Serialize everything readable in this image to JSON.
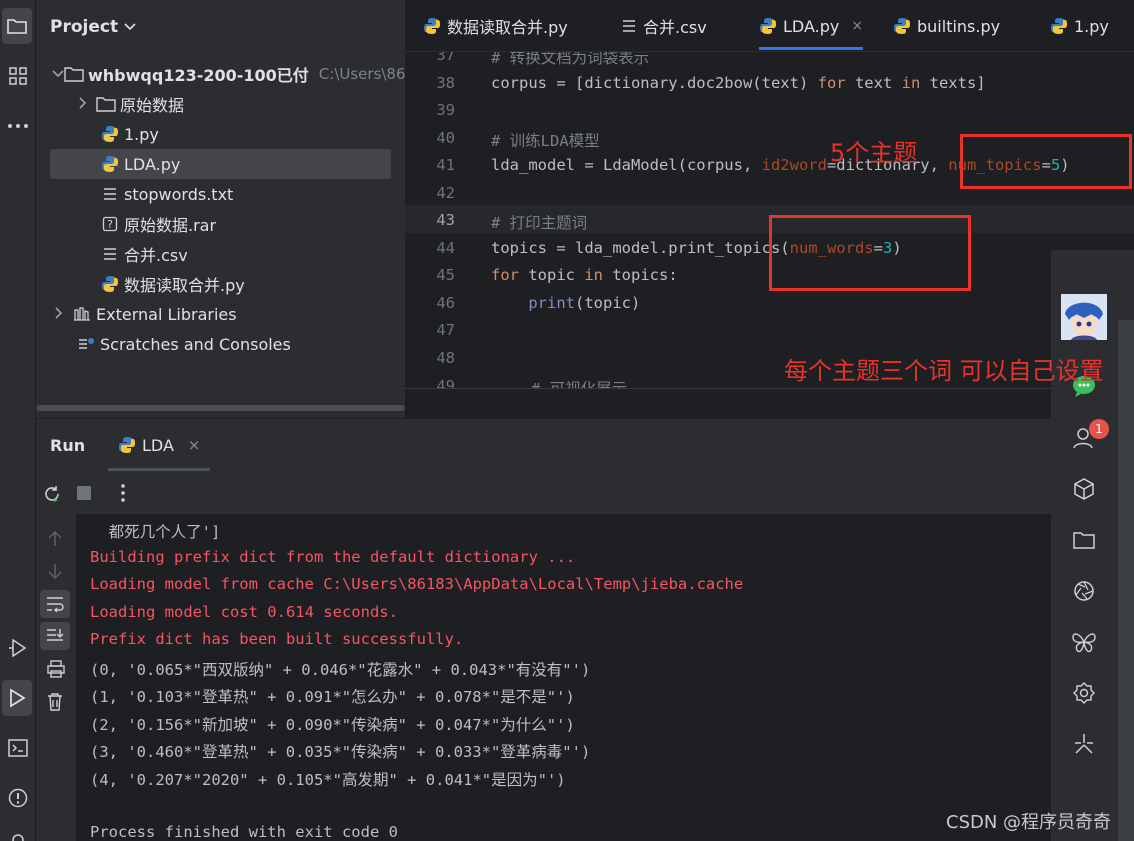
{
  "project": {
    "header": "Project",
    "tree": [
      {
        "label": "whbwqq123-200-100已付",
        "sub": "C:\\Users\\86",
        "type": "folder",
        "expanded": true
      },
      {
        "label": "原始数据",
        "type": "folder",
        "expanded": false
      },
      {
        "label": "1.py",
        "type": "python"
      },
      {
        "label": "LDA.py",
        "type": "python",
        "selected": true
      },
      {
        "label": "stopwords.txt",
        "type": "text"
      },
      {
        "label": "原始数据.rar",
        "type": "unknown"
      },
      {
        "label": "合并.csv",
        "type": "text"
      },
      {
        "label": "数据读取合并.py",
        "type": "python"
      },
      {
        "label": "External Libraries",
        "type": "library"
      },
      {
        "label": "Scratches and Consoles",
        "type": "scratch"
      }
    ]
  },
  "editor": {
    "tabs": [
      {
        "label": "数据读取合并.py",
        "type": "python"
      },
      {
        "label": "合并.csv",
        "type": "text"
      },
      {
        "label": "LDA.py",
        "type": "python",
        "active": true,
        "close": "×"
      },
      {
        "label": "builtins.py",
        "type": "python"
      },
      {
        "label": "1.py",
        "type": "python"
      }
    ],
    "line_numbers": [
      "37",
      "38",
      "39",
      "40",
      "41",
      "42",
      "43",
      "44",
      "45",
      "46",
      "47",
      "48",
      "49"
    ],
    "lines": {
      "l37": "# 转换文档为词袋表示",
      "l38_a": "corpus = [dictionary.doc2bow(text) ",
      "l38_for": "for",
      "l38_b": " text ",
      "l38_in": "in",
      "l38_c": " texts]",
      "l40": "# 训练LDA模型",
      "l41_a": "lda_model = LdaModel(corpus, ",
      "l41_p1": "id2word",
      "l41_b": "=dictionary, ",
      "l41_p2": "num_topics",
      "l41_eq": "=",
      "l41_n": "5",
      "l41_c": ")",
      "l43": "# 打印主题词",
      "l44_a": "topics = lda_model.print_topics(",
      "l44_p": "num_words",
      "l44_eq": "=",
      "l44_n": "3",
      "l44_c": ")",
      "l45_for": "for",
      "l45_a": " topic ",
      "l45_in": "in",
      "l45_b": " topics:",
      "l46_fn": "print",
      "l46_a": "(topic)",
      "l49": "# 可视化展示"
    },
    "annotations": {
      "topics_note": "5个主题",
      "words_note": "每个主题三个词 可以自己设置"
    }
  },
  "run": {
    "title": "Run",
    "tab": "LDA",
    "tab_close": "×",
    "console": [
      {
        "text": "  都死几个人了']",
        "style": "norm"
      },
      {
        "text": "Building prefix dict from the default dictionary ...",
        "style": "err"
      },
      {
        "text": "Loading model from cache C:\\Users\\86183\\AppData\\Local\\Temp\\jieba.cache",
        "style": "err"
      },
      {
        "text": "Loading model cost 0.614 seconds.",
        "style": "err"
      },
      {
        "text": "Prefix dict has been built successfully.",
        "style": "err"
      },
      {
        "text": "(0, '0.065*\"西双版纳\" + 0.046*\"花露水\" + 0.043*\"有没有\"')",
        "style": "norm"
      },
      {
        "text": "(1, '0.103*\"登革热\" + 0.091*\"怎么办\" + 0.078*\"是不是\"')",
        "style": "norm"
      },
      {
        "text": "(2, '0.156*\"新加坡\" + 0.090*\"传染病\" + 0.047*\"为什么\"')",
        "style": "norm"
      },
      {
        "text": "(3, '0.460*\"登革热\" + 0.035*\"传染病\" + 0.033*\"登革病毒\"')",
        "style": "norm"
      },
      {
        "text": "(4, '0.207*\"2020\" + 0.105*\"高发期\" + 0.041*\"是因为\"')",
        "style": "norm"
      },
      {
        "text": "",
        "style": "norm"
      },
      {
        "text": "Process finished with exit code 0",
        "style": "norm"
      }
    ]
  },
  "right_bar": {
    "badge": "1"
  },
  "watermark": "CSDN @程序员奇奇",
  "colors": {
    "accent": "#3574f0",
    "annotation": "#e8332a",
    "error_text": "#f75464",
    "python_blue": "#3c7ebf",
    "python_yellow": "#f2c53d"
  }
}
